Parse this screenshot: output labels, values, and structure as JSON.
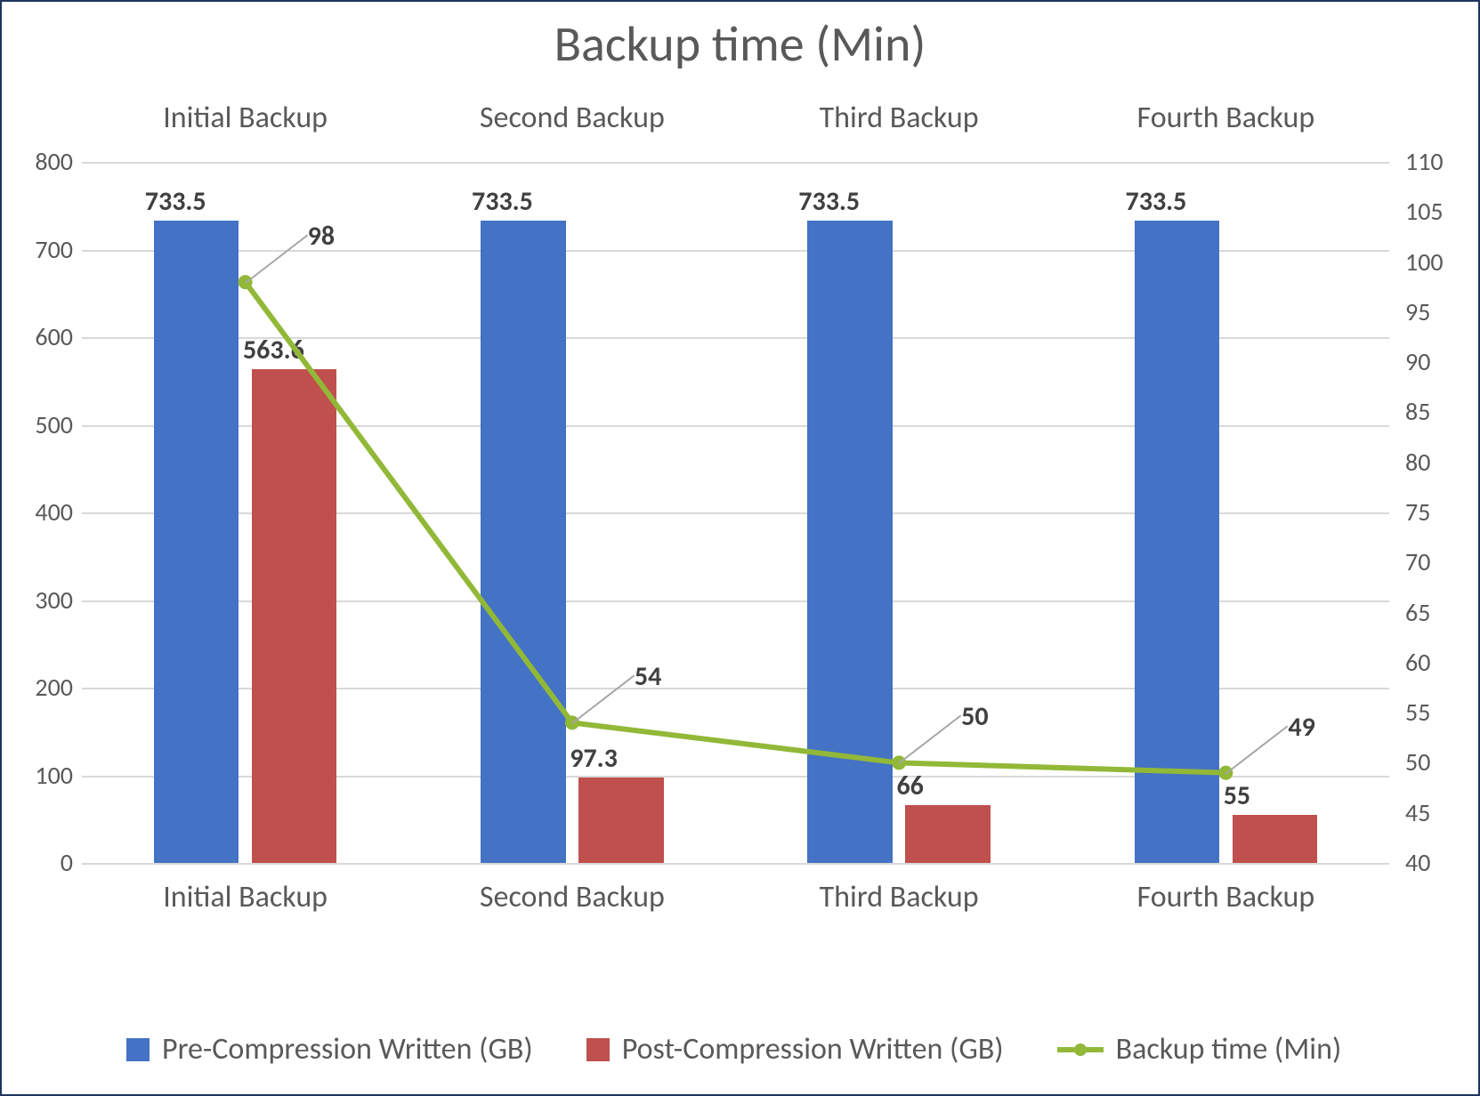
{
  "chart_data": {
    "type": "bar",
    "title": "Backup time (Min)",
    "categories": [
      "Initial Backup",
      "Second Backup",
      "Third Backup",
      "Fourth Backup"
    ],
    "series": [
      {
        "name": "Pre-Compression Written (GB)",
        "axis": "left",
        "type": "bar",
        "values": [
          733.5,
          733.5,
          733.5,
          733.5
        ],
        "color": "#4472c4"
      },
      {
        "name": "Post-Compression Written (GB)",
        "axis": "left",
        "type": "bar",
        "values": [
          563.6,
          97.3,
          66,
          55
        ],
        "color": "#c0504d"
      },
      {
        "name": "Backup time (Min)",
        "axis": "right",
        "type": "line",
        "values": [
          98,
          54,
          50,
          49
        ],
        "color": "#92b838"
      }
    ],
    "ylim_left": [
      0,
      800
    ],
    "ylim_right": [
      40,
      110
    ],
    "left_ticks": [
      0,
      100,
      200,
      300,
      400,
      500,
      600,
      700,
      800
    ],
    "right_ticks": [
      40,
      45,
      50,
      55,
      60,
      65,
      70,
      75,
      80,
      85,
      90,
      95,
      100,
      105,
      110
    ],
    "xlabel": "",
    "ylabel_left": "",
    "ylabel_right": ""
  }
}
